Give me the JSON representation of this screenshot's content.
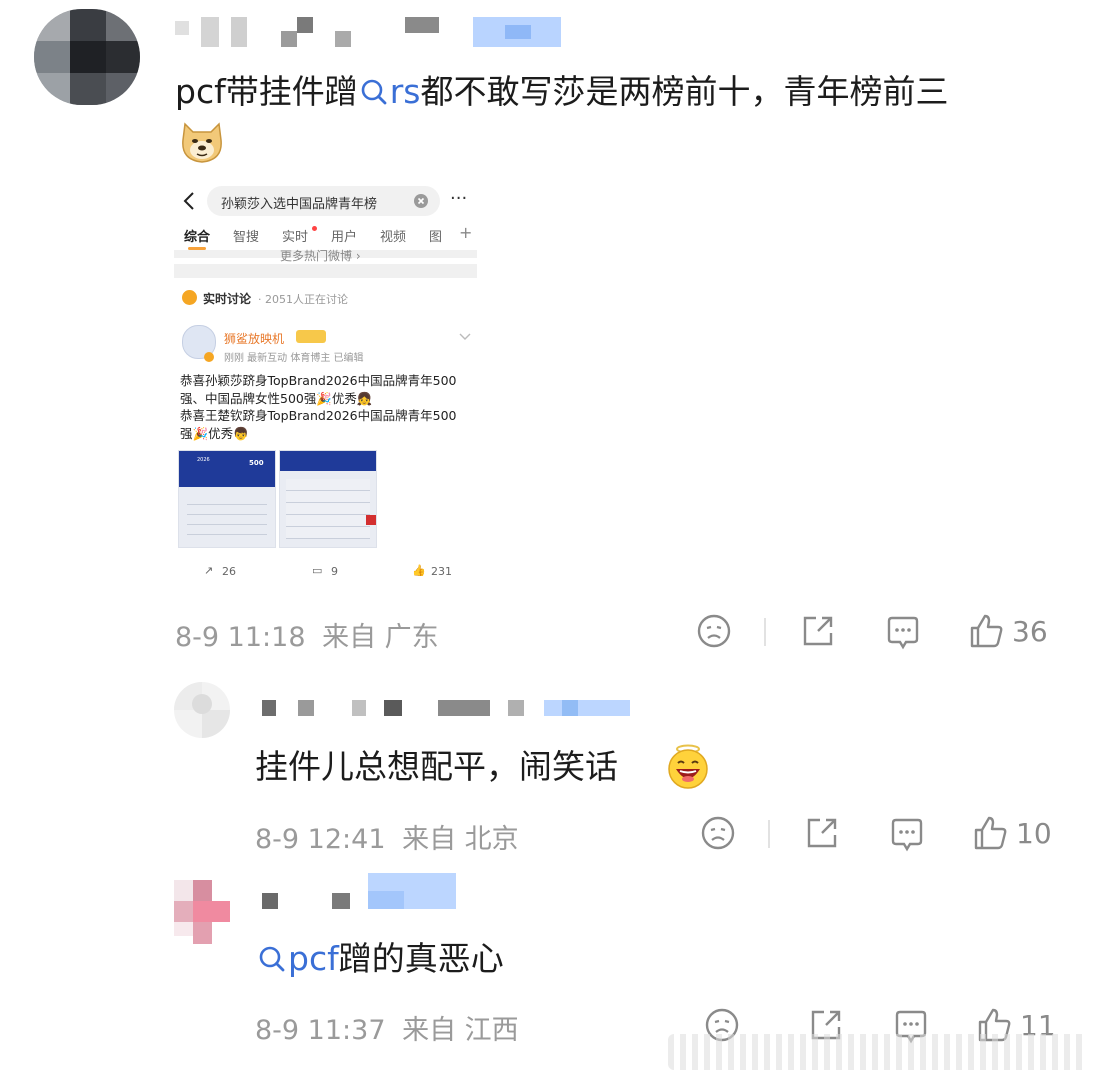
{
  "comments": [
    {
      "text_prefix": "pcf带挂件蹭",
      "search_term": "rs",
      "text_suffix": "都不敢写莎是两榜前十，青年榜前三",
      "emoji": "doge",
      "time": "8-9 11:18",
      "from": "来自 广东",
      "likes": "36"
    },
    {
      "text": "挂件儿总想配平，闹笑话",
      "emoji": "laugh",
      "time": "8-9 12:41",
      "from": "来自 北京",
      "likes": "10"
    },
    {
      "search_term": "pcf",
      "text_suffix": "蹭的真恶心",
      "time": "8-9 11:37",
      "from": "来自 江西",
      "likes": "11"
    }
  ],
  "screenshot": {
    "search_query": "孙颖莎入选中国品牌青年榜",
    "tabs": [
      "综合",
      "智搜",
      "实时",
      "用户",
      "视频",
      "图"
    ],
    "more_hot": "更多热门微博 ›",
    "discussion_title": "实时讨论",
    "discussion_count": "· 2051人正在讨论",
    "poster_name": "狮鲨放映机",
    "poster_meta": "刚刚 最新互动  体育博主  已编辑",
    "post_line1": "恭喜孙颖莎跻身TopBrand2026中国品牌青年500",
    "post_line2": "强、中国品牌女性500强🎉优秀👧",
    "post_line3": "恭喜王楚钦跻身TopBrand2026中国品牌青年500",
    "post_line4": "强🎉优秀👦",
    "doc1_title": "2026",
    "doc1_badge": "500",
    "reposts": "26",
    "comments": "9",
    "likes": "231"
  },
  "icons": [
    "search-icon",
    "doge-emoji",
    "laugh-emoji",
    "sad-icon",
    "share-icon",
    "comment-icon",
    "like-icon"
  ],
  "colors": {
    "link": "#3a6fd6",
    "meta": "#9a9a9a",
    "brand_doc": "#1f3a99"
  }
}
